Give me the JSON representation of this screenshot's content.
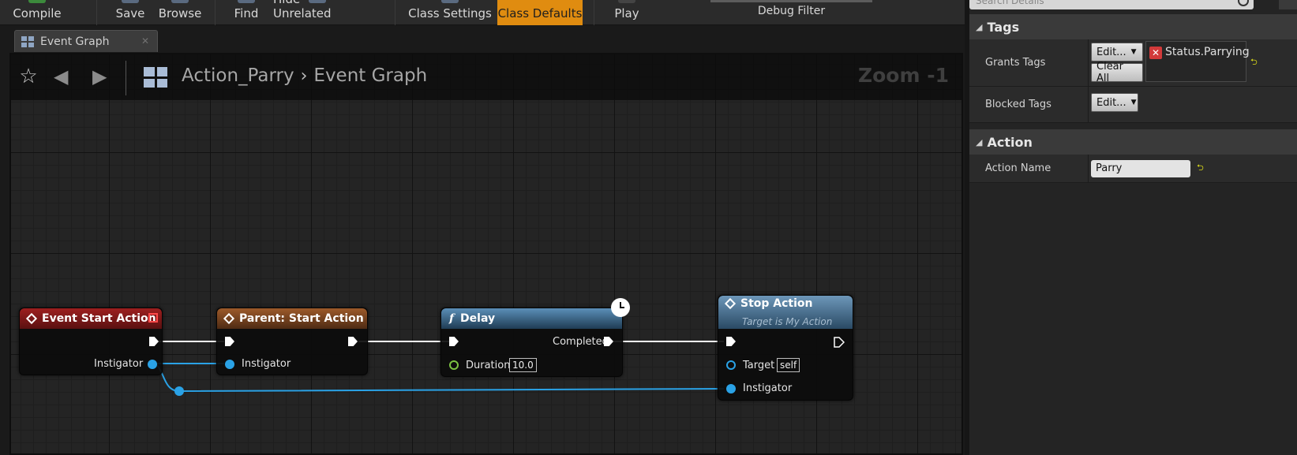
{
  "toolbar": {
    "buttons": [
      {
        "label": "Compile"
      },
      {
        "label": "Save"
      },
      {
        "label": "Browse"
      },
      {
        "label": "Find"
      },
      {
        "label": "Hide Unrelated"
      },
      {
        "label": "Class Settings"
      },
      {
        "label": "Class Defaults",
        "active": true
      },
      {
        "label": "Play"
      }
    ],
    "debug_filter_label": "Debug Filter",
    "active_color": "#e08c10"
  },
  "tab": {
    "label": "Event Graph",
    "close_icon": "close-icon"
  },
  "graph": {
    "breadcrumb": {
      "asset": "Action_Parry",
      "graph": "Event Graph"
    },
    "zoom": "Zoom -1",
    "nodes": {
      "event_start": {
        "title": "Event Start Action",
        "out_pin_label": "Instigator",
        "color": "#9d1f1f"
      },
      "parent_start": {
        "title": "Parent: Start Action",
        "in_pin_label": "Instigator",
        "color": "#9c5a2a"
      },
      "delay": {
        "title": "Delay",
        "completed_label": "Completed",
        "duration_label": "Duration",
        "duration_value": "10.0",
        "color": "#5b8fb8"
      },
      "stop_action": {
        "title": "Stop Action",
        "subtitle": "Target is My Action",
        "target_label": "Target",
        "target_value": "self",
        "instigator_label": "Instigator",
        "color": "#6d97b9"
      }
    },
    "pin_colors": {
      "exec": "#ffffff",
      "object": "#2aa2e6",
      "float": "#7cc242"
    }
  },
  "details": {
    "search_placeholder": "Search Details",
    "categories": {
      "tags": {
        "title": "Tags",
        "grants_tags_label": "Grants Tags",
        "edit_label": "Edit...",
        "clear_all_label": "Clear All",
        "granted_tag": "Status.Parrying",
        "blocked_tags_label": "Blocked Tags",
        "blocked_edit_label": "Edit..."
      },
      "action": {
        "title": "Action",
        "action_name_label": "Action Name",
        "action_name_value": "Parry"
      }
    }
  }
}
